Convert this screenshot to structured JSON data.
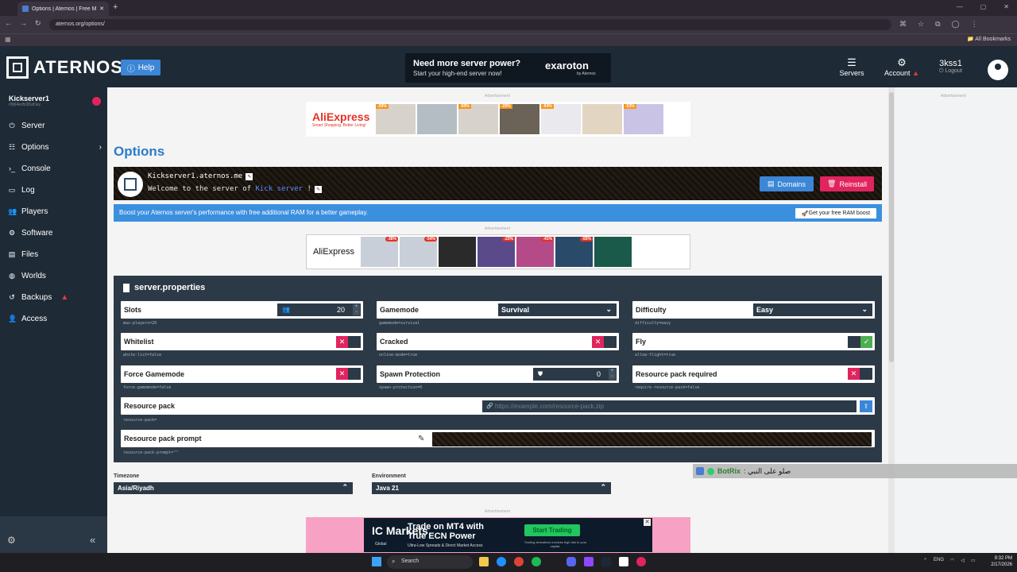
{
  "browser": {
    "tab_title": "Options | Aternos | Free Minecraft",
    "url": "aternos.org/options/",
    "all_bookmarks": "All Bookmarks"
  },
  "header": {
    "logo_text": "ATERNOS",
    "help_label": "Help",
    "ad": {
      "line1": "Need more server power?",
      "line2": "Start your high-end server now!",
      "brand": "exaroton",
      "brand_sub": "by Aternos"
    },
    "servers_label": "Servers",
    "account_label": "Account",
    "username": "3kss1",
    "logout_label": "Logout"
  },
  "sidebar": {
    "server_name": "Kickserver1",
    "server_id": "#9j64ezfx3lSzDey",
    "items": [
      {
        "label": "Server",
        "icon": "power-icon"
      },
      {
        "label": "Options",
        "icon": "sliders-icon"
      },
      {
        "label": "Console",
        "icon": "terminal-icon"
      },
      {
        "label": "Log",
        "icon": "log-icon"
      },
      {
        "label": "Players",
        "icon": "users-icon"
      },
      {
        "label": "Software",
        "icon": "gear-icon"
      },
      {
        "label": "Files",
        "icon": "folder-icon"
      },
      {
        "label": "Worlds",
        "icon": "globe-icon"
      },
      {
        "label": "Backups",
        "icon": "backup-icon"
      },
      {
        "label": "Access",
        "icon": "user-icon"
      }
    ]
  },
  "ads": {
    "label": "Advertisement",
    "ad1_brand": "AliExpress",
    "ad1_tagline": "Smart Shopping. Better Living!",
    "ad1_discounts": [
      "-26%",
      "",
      "-50%",
      "-25%",
      "-54%",
      "",
      "-53%"
    ],
    "ad2_brand": "AliExpress",
    "ad2_discounts": [
      "-38%",
      "-54%",
      "",
      "-23%",
      "-41%",
      "-55%",
      ""
    ],
    "ad3": {
      "brand": "IC Markets",
      "brand_sub": "Global",
      "headline1": "Trade on MT4 with",
      "headline2": "True ECN Power",
      "sub": "Ultra-Low Spreads & Direct Market Access",
      "cta": "Start Trading",
      "cta_sub": "Trading derivatives involves high risk to your capital."
    }
  },
  "page": {
    "title": "Options",
    "address": "Kickserver1.aternos.me",
    "motd_prefix": "Welcome to the server of ",
    "motd_name": "Kick server",
    "motd_suffix": " !",
    "domains_label": "Domains",
    "reinstall_label": "Reinstall",
    "ram_text": "Boost your Aternos server's performance with free additional RAM for a better gameplay.",
    "ram_button": "Get your free RAM boost"
  },
  "properties": {
    "title": "server.properties",
    "slots": {
      "label": "Slots",
      "value": "20",
      "key": "max-players=20"
    },
    "gamemode": {
      "label": "Gamemode",
      "value": "Survival",
      "key": "gamemode=survival"
    },
    "difficulty": {
      "label": "Difficulty",
      "value": "Easy",
      "key": "difficulty=easy"
    },
    "whitelist": {
      "label": "Whitelist",
      "key": "white-list=false",
      "on": false
    },
    "cracked": {
      "label": "Cracked",
      "key": "online-mode=true",
      "on": false
    },
    "fly": {
      "label": "Fly",
      "key": "allow-flight=true",
      "on": true
    },
    "force_gamemode": {
      "label": "Force Gamemode",
      "key": "force-gamemode=false",
      "on": false
    },
    "spawn_protection": {
      "label": "Spawn Protection",
      "value": "0",
      "key": "spawn-protection=0"
    },
    "rp_required": {
      "label": "Resource pack required",
      "key": "require-resource-pack=false",
      "on": false
    },
    "resource_pack": {
      "label": "Resource pack",
      "placeholder": "https://example.com/resource-pack.zip",
      "key": "resource-pack="
    },
    "rp_prompt": {
      "label": "Resource pack prompt",
      "key": "resource-pack-prompt=\"\""
    }
  },
  "settings": {
    "timezone_label": "Timezone",
    "timezone_value": "Asia/Riyadh",
    "environment_label": "Environment",
    "environment_value": "Java 21"
  },
  "overlay": {
    "bot": "BotRix",
    "message": "صلو على النبي :"
  },
  "taskbar": {
    "search": "Search",
    "lang": "ENG",
    "time": "9:32 PM",
    "date": "2/17/2026"
  },
  "colors": {
    "accent": "#3b86d6",
    "danger": "#e0245e",
    "sidebar": "#1e2a36",
    "panel": "#2c3a47",
    "success": "#4caf50"
  }
}
